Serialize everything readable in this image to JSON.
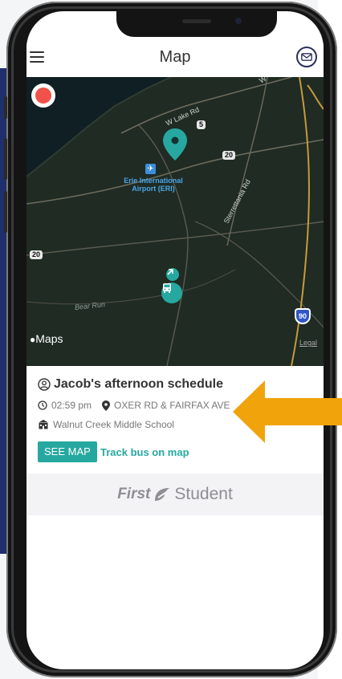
{
  "header": {
    "title": "Map",
    "menu_icon": "hamburger-icon",
    "mail_icon": "envelope-icon"
  },
  "map": {
    "road_labels": {
      "w_lake_rd": "W Lake Rd",
      "sterrettania_rd": "Sterrettania Rd",
      "bear_run": "Bear Run",
      "w_top": "W"
    },
    "shields": {
      "route_5": "5",
      "route_20_east": "20",
      "route_20_west": "20",
      "interstate_90": "90"
    },
    "airport_label": "Erie International Airport (ERI)",
    "brand_label": "Maps",
    "legal_label": "Legal",
    "colors": {
      "land": "#1f2b23",
      "water": "#0f1f24",
      "roads": "#6d6b5c",
      "highway": "#c79a3a",
      "marker": "#26a8a0",
      "airport": "#4aa6e8"
    }
  },
  "schedule": {
    "title": "Jacob's afternoon schedule",
    "time": "02:59 pm",
    "location": "OXER RD & FAIRFAX AVE",
    "school": "Walnut Creek Middle School",
    "see_map_label": "SEE MAP",
    "track_label": "Track bus on map"
  },
  "footer": {
    "brand_first": "First",
    "brand_second": "Student"
  },
  "annotation": {
    "arrow_color": "#f0a30a"
  }
}
